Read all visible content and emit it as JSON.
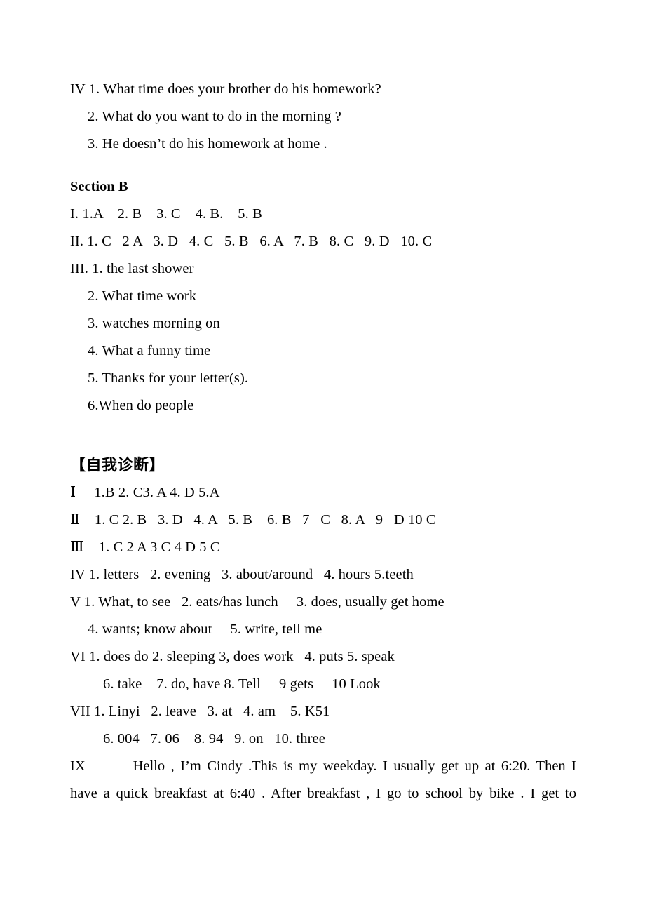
{
  "document": {
    "section_a_tail": {
      "label": "IV",
      "lines": [
        "IV 1. What time does your brother do his homework?",
        "2. What do you want to do in the morning ?",
        "3. He doesn’t do his homework at home ."
      ]
    },
    "section_b": {
      "heading": "Section B",
      "group_i": "I. 1.A    2. B    3. C    4. B.    5. B",
      "group_ii": "II. 1. C   2 A   3. D   4. C   5. B   6. A   7. B   8. C   9. D   10. C",
      "group_iii_first": "III. 1. the last shower",
      "group_iii_rest": [
        "2. What time work",
        "3. watches morning on",
        "4. What a funny time",
        "5. Thanks for your letter(s).",
        "6.When do people"
      ]
    },
    "self_diagnosis": {
      "heading": "【自我诊断】",
      "rows": [
        "Ⅰ     1.B 2. C3. A 4. D 5.A",
        "Ⅱ    1. C 2. B   3. D   4. A   5. B    6. B   7   C   8. A   9   D 10 C",
        "Ⅲ    1. C 2 A 3 C 4 D 5 C",
        "IV 1. letters   2. evening   3. about/around   4. hours 5.teeth",
        "V 1. What, to see   2. eats/has lunch     3. does, usually get home",
        "4. wants; know about     5. write, tell me",
        "VI 1. does do 2. sleeping 3, does work   4. puts 5. speak",
        "6. take    7. do, have 8. Tell     9 gets     10 Look",
        "VII 1. Linyi   2. leave   3. at   4. am    5. K51",
        "6. 004   7. 06    8. 94   9. on   10. three"
      ],
      "final_answer": {
        "label": "IX",
        "line1": "IX        Hello , I’m Cindy .This is my weekday. I usually get up at 6:20. Then I",
        "line2": "have a quick breakfast at 6:40 . After breakfast , I go to school by bike . I get to"
      }
    }
  }
}
